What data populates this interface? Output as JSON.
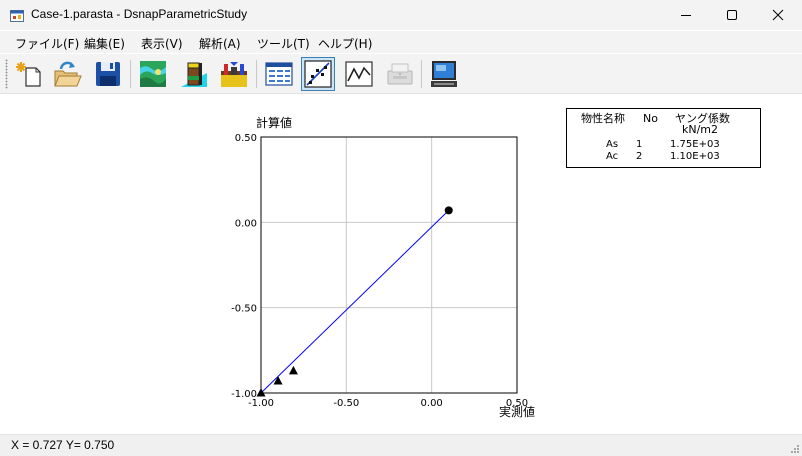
{
  "window": {
    "title": "Case-1.parasta - DsnapParametricStudy",
    "icon": "app-icon"
  },
  "menu": [
    {
      "label": "ファイル(F)"
    },
    {
      "label": "編集(E)"
    },
    {
      "label": "表示(V)"
    },
    {
      "label": "解析(A)"
    },
    {
      "label": "ツール(T)"
    },
    {
      "label": "ヘルプ(H)"
    }
  ],
  "toolbar": [
    {
      "icon": "new-file-icon"
    },
    {
      "icon": "open-folder-icon"
    },
    {
      "icon": "save-disk-icon"
    },
    {
      "icon": "terrain-map-icon"
    },
    {
      "icon": "soil-column-icon"
    },
    {
      "icon": "ground-model-icon"
    },
    {
      "icon": "table-view-icon"
    },
    {
      "icon": "scatter-plot-icon",
      "pressed": true
    },
    {
      "icon": "line-graph-icon"
    },
    {
      "icon": "print-preview-icon",
      "disabled": true
    },
    {
      "icon": "computer-display-icon"
    }
  ],
  "legend": {
    "headers": [
      "物性名称",
      "No",
      "ヤング係数"
    ],
    "unit": "kN/m2",
    "rows": [
      {
        "name": "As",
        "no": "1",
        "value": "1.75E+03"
      },
      {
        "name": "Ac",
        "no": "2",
        "value": "1.10E+03"
      }
    ]
  },
  "status": {
    "text": "X = 0.727  Y= 0.750"
  },
  "colors": {
    "fit_line": "#0000ff",
    "grid": "#c8c8c8",
    "markers": "#000000"
  },
  "chart_data": {
    "type": "scatter",
    "xlabel": "実測値",
    "ylabel": "計算値",
    "xlim": [
      -1.0,
      0.5
    ],
    "ylim": [
      -1.0,
      0.5
    ],
    "xticks": [
      "-1.00",
      "-0.50",
      "0.00",
      "0.50"
    ],
    "yticks": [
      "0.50",
      "0.00",
      "-0.50",
      "-1.00"
    ],
    "xtick_values": [
      -1.0,
      -0.5,
      0.0,
      0.5
    ],
    "ytick_values": [
      0.5,
      0.0,
      -0.5,
      -1.0
    ],
    "grid": true,
    "series": [
      {
        "marker": "triangle",
        "points": [
          [
            -1.0,
            -1.0
          ],
          [
            -0.9,
            -0.93
          ],
          [
            -0.81,
            -0.87
          ]
        ]
      },
      {
        "marker": "circle",
        "points": [
          [
            0.1,
            0.07
          ]
        ]
      }
    ],
    "line": {
      "from": [
        -1.0,
        -1.0
      ],
      "to": [
        0.1,
        0.07
      ]
    }
  }
}
